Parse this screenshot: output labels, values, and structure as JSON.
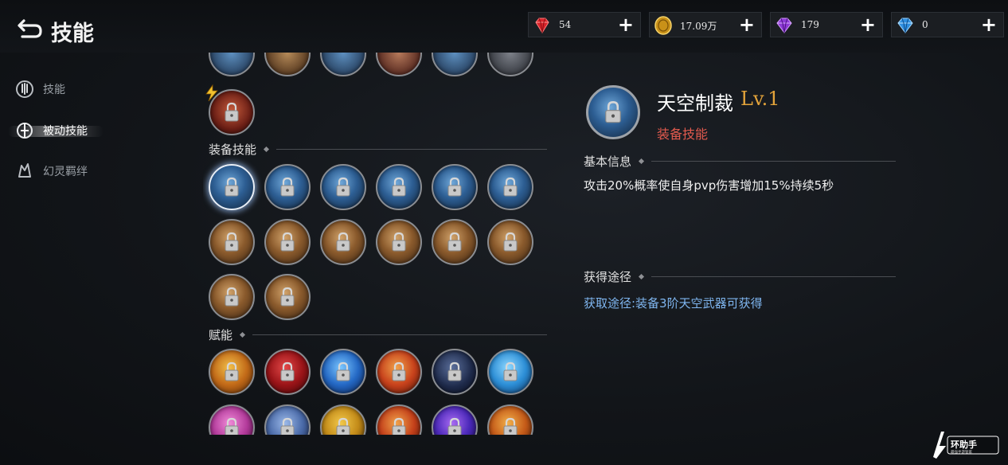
{
  "header": {
    "title": "技能"
  },
  "currencies": [
    {
      "name": "red-gem-icon",
      "amount": "54",
      "color": "#d8232a"
    },
    {
      "name": "gold-coin-icon",
      "amount": "17.09万",
      "color": "#d9a520"
    },
    {
      "name": "purple-gem-icon",
      "amount": "179",
      "color": "#9b3fe0"
    },
    {
      "name": "blue-diamond-icon",
      "amount": "0",
      "color": "#3fa6ef"
    }
  ],
  "sidebar": {
    "items": [
      {
        "label": "技能",
        "icon": "skill-icon",
        "active": false
      },
      {
        "label": "被动技能",
        "icon": "passive-skill-icon",
        "active": true
      },
      {
        "label": "幻灵羁绊",
        "icon": "phantom-bond-icon",
        "active": false
      }
    ]
  },
  "sections": {
    "equip": {
      "label": "装备技能"
    },
    "talent": {
      "label": "赋能"
    }
  },
  "detail": {
    "name": "天空制裁",
    "level": "Lv.1",
    "type": "装备技能",
    "basic_info_label": "基本信息",
    "description": "攻击20%概率使自身pvp伤害增加15%持续5秒",
    "source_label": "获得途径",
    "source_text": "获取途径:装备3阶天空武器可获得"
  },
  "colors": {
    "accent_level": "#e3a33a",
    "skill_type": "#e25a4e",
    "source_text": "#7fb6f0",
    "description": "#f0f0f0"
  },
  "watermark": {
    "main": "环助手",
    "sub": "最强手游管家"
  }
}
